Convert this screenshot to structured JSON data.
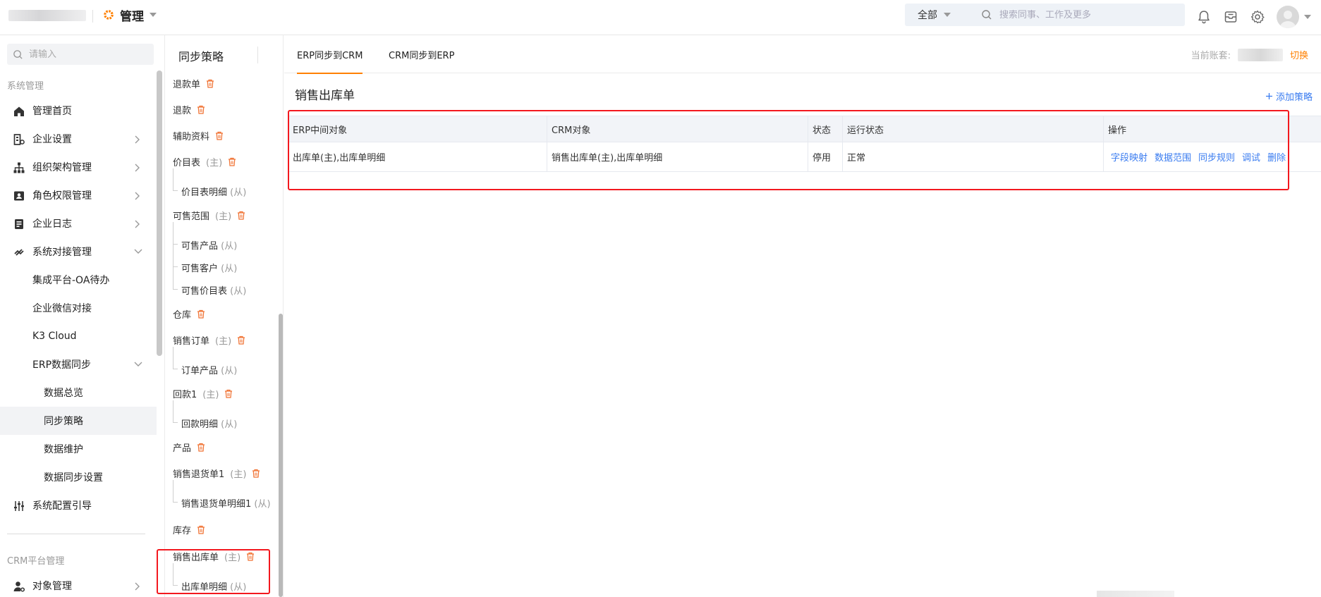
{
  "header": {
    "app_name": "管理",
    "search_scope": "全部",
    "search_placeholder": "搜索同事、工作及更多",
    "icons": [
      "bell-icon",
      "inbox-icon",
      "gear-icon",
      "avatar"
    ]
  },
  "sidebar": {
    "search_placeholder": "请输入",
    "section_system": "系统管理",
    "items": [
      {
        "label": "管理首页",
        "icon": "home-icon"
      },
      {
        "label": "企业设置",
        "icon": "building-icon"
      },
      {
        "label": "组织架构管理",
        "icon": "org-chart-icon"
      },
      {
        "label": "角色权限管理",
        "icon": "id-card-icon"
      },
      {
        "label": "企业日志",
        "icon": "log-icon"
      },
      {
        "label": "系统对接管理",
        "icon": "link-icon"
      },
      {
        "label": "集成平台-OA待办"
      },
      {
        "label": "企业微信对接"
      },
      {
        "label": "K3 Cloud"
      },
      {
        "label": "ERP数据同步"
      },
      {
        "label": "数据总览"
      },
      {
        "label": "同步策略"
      },
      {
        "label": "数据维护"
      },
      {
        "label": "数据同步设置"
      },
      {
        "label": "系统配置引导",
        "icon": "sliders-icon"
      }
    ],
    "section_crm": "CRM平台管理",
    "crm_items": [
      {
        "label": "对象管理",
        "icon": "user-settings-icon"
      }
    ]
  },
  "objects_pane": {
    "title": "同步策略",
    "items": [
      {
        "label": "退款单",
        "tag": ""
      },
      {
        "label": "退款",
        "tag": ""
      },
      {
        "label": "辅助资料",
        "tag": ""
      },
      {
        "label": "价目表",
        "tag": "(主)"
      },
      {
        "label": "价目表明细",
        "tag": "(从)"
      },
      {
        "label": "可售范围",
        "tag": "(主)"
      },
      {
        "label": "可售产品",
        "tag": "(从)"
      },
      {
        "label": "可售客户",
        "tag": "(从)"
      },
      {
        "label": "可售价目表",
        "tag": "(从)"
      },
      {
        "label": "仓库",
        "tag": ""
      },
      {
        "label": "销售订单",
        "tag": "(主)"
      },
      {
        "label": "订单产品",
        "tag": "(从)"
      },
      {
        "label": "回款1",
        "tag": "(主)"
      },
      {
        "label": "回款明细",
        "tag": "(从)"
      },
      {
        "label": "产品",
        "tag": ""
      },
      {
        "label": "销售退货单1",
        "tag": "(主)"
      },
      {
        "label": "销售退货单明细1",
        "tag": "(从)"
      },
      {
        "label": "库存",
        "tag": ""
      },
      {
        "label": "销售出库单",
        "tag": "(主)"
      },
      {
        "label": "出库单明细",
        "tag": "(从)"
      }
    ]
  },
  "tabs": [
    {
      "label": "ERP同步到CRM"
    },
    {
      "label": "CRM同步到ERP"
    }
  ],
  "account": {
    "label": "当前账套:",
    "switch": "切换"
  },
  "content": {
    "title": "销售出库单",
    "add_policy": "添加策略",
    "columns": [
      "ERP中间对象",
      "CRM对象",
      "状态",
      "运行状态",
      "操作"
    ],
    "rows": [
      {
        "erp_object": "出库单(主),出库单明细",
        "crm_object": "销售出库单(主),出库单明细",
        "status": "停用",
        "run_status": "正常",
        "actions": [
          "字段映射",
          "数据范围",
          "同步规则",
          "调试",
          "删除"
        ]
      }
    ]
  },
  "colors": {
    "accent": "#ff8000",
    "link": "#3a7cf0",
    "highlight": "#f3181e"
  }
}
